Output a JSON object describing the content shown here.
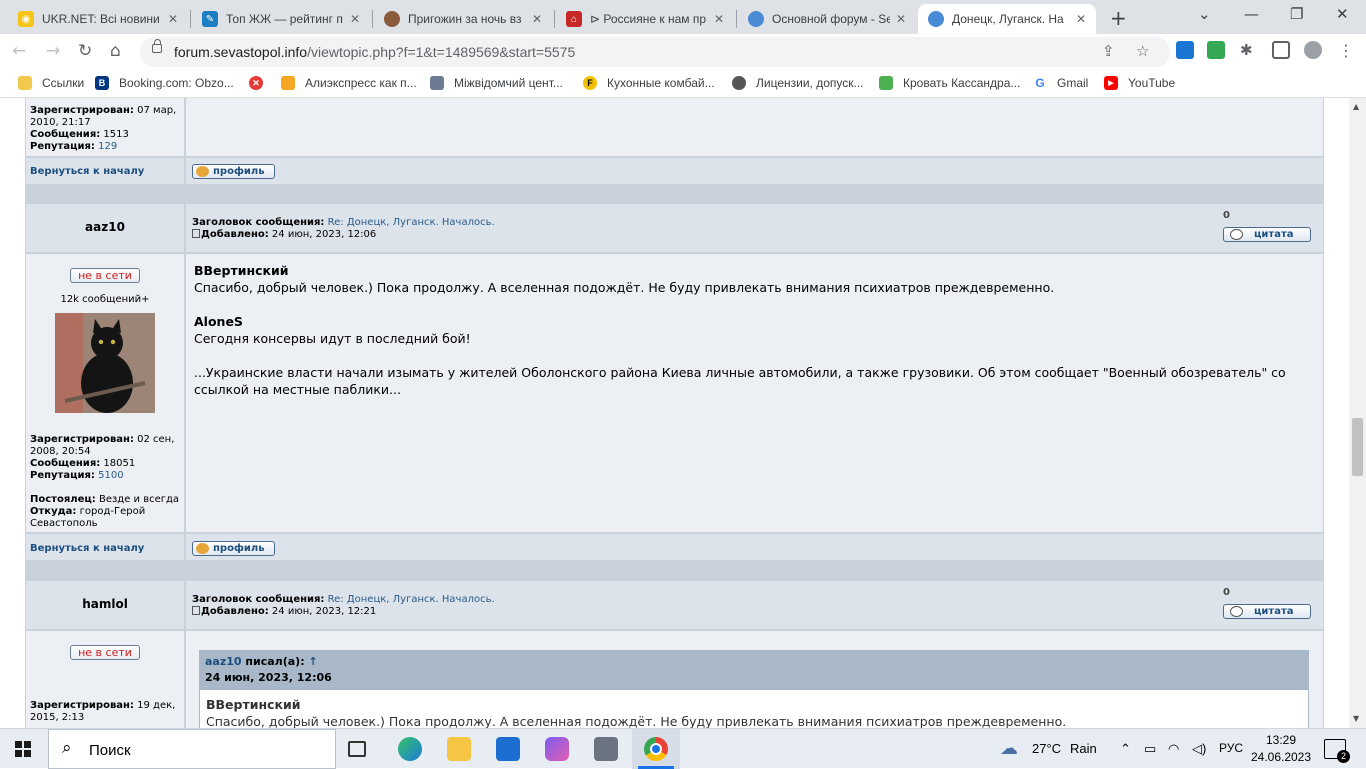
{
  "browser": {
    "tabs": [
      {
        "title": "UKR.NET: Всі новини",
        "icon": "ukrnet-icon",
        "color": "#f5c518"
      },
      {
        "title": "Топ ЖЖ — рейтинг п",
        "icon": "livejournal-icon",
        "color": "#1b7fc1"
      },
      {
        "title": "Пригожин за ночь вз",
        "icon": "portrait-icon",
        "color": "#8a5a3a"
      },
      {
        "title": "⊳ Россияне к нам пр",
        "icon": "house-icon",
        "color": "#c62828"
      },
      {
        "title": "Основной форум - Se",
        "icon": "forum-icon",
        "color": "#4a8bd6"
      },
      {
        "title": "Донецк, Луганск. На",
        "icon": "forum-icon",
        "color": "#4a8bd6"
      }
    ],
    "url_host": "forum.sevastopol.info",
    "url_path": "/viewtopic.php?f=1&t=1489569&start=5575",
    "bookmarks": [
      {
        "label": "Ссылки",
        "icon": "folder-icon",
        "color": "#f2c94c",
        "glyph": ""
      },
      {
        "label": "Booking.com: Obzo...",
        "icon": "booking-icon",
        "color": "#003580",
        "glyph": "B"
      },
      {
        "label": "",
        "icon": "red-x-icon",
        "color": "#e53935",
        "glyph": "✕"
      },
      {
        "label": "Алиэкспресс как п...",
        "icon": "box-icon",
        "color": "#f5a623",
        "glyph": ""
      },
      {
        "label": "Міжвідомчий цент...",
        "icon": "grid-icon",
        "color": "#6c7b95",
        "glyph": ""
      },
      {
        "label": "Кухонные комбай...",
        "icon": "yellow-circle-icon",
        "color": "#f2c200",
        "glyph": "F"
      },
      {
        "label": "Лицензии, допуск...",
        "icon": "globe-icon",
        "color": "#555555",
        "glyph": ""
      },
      {
        "label": "Кровать Кассандра...",
        "icon": "green-star-icon",
        "color": "#4caf50",
        "glyph": ""
      },
      {
        "label": "Gmail",
        "icon": "google-icon",
        "color": "#4285f4",
        "glyph": "G"
      },
      {
        "label": "YouTube",
        "icon": "youtube-icon",
        "color": "#ff0000",
        "glyph": "▶"
      }
    ]
  },
  "post_prev": {
    "registered_label": "Зарегистрирован:",
    "registered_value": "07 мар, 2010, 21:17",
    "messages_label": "Сообщения:",
    "messages_value": "1513",
    "reputation_label": "Репутация:",
    "reputation_value": "129",
    "back_link": "Вернуться к началу",
    "profile_btn": "профиль"
  },
  "post1": {
    "author": "aaz10",
    "subject_label": "Заголовок сообщения:",
    "subject_value": "Re: Донецк, Луганск. Началось.",
    "added_label": "Добавлено:",
    "added_value": "24 июн, 2023, 12:06",
    "rating": "0",
    "quote_btn": "цитата",
    "status": "не в сети",
    "msg_count": "12k сообщений+",
    "registered_label": "Зарегистрирован:",
    "registered_value": "02 сен, 2008, 20:54",
    "messages_label": "Сообщения:",
    "messages_value": "18051",
    "reputation_label": "Репутация:",
    "reputation_value": "5100",
    "resident_label": "Постоялец:",
    "resident_value": "Везде и всегда",
    "from_label": "Откуда:",
    "from_value": "город-Герой Севастополь",
    "body": {
      "name1": "BВертинский",
      "line1": "Спасибо, добрый человек.) Пока продолжу. А вселенная подождёт. Не буду привлекать внимания психиатров преждевременно.",
      "name2": "AloneS",
      "line2": "Сегодня консервы идут в последний бой!",
      "line3": "...Украинские власти начали изымать у жителей Оболонского района Киева личные автомобили, а также грузовики. Об этом сообщает \"Военный обозреватель\" со ссылкой на местные паблики..."
    },
    "back_link": "Вернуться к началу",
    "profile_btn": "профиль"
  },
  "post2": {
    "author": "hamlol",
    "subject_label": "Заголовок сообщения:",
    "subject_value": "Re: Донецк, Луганск. Началось.",
    "added_label": "Добавлено:",
    "added_value": "24 июн, 2023, 12:21",
    "rating": "0",
    "quote_btn": "цитата",
    "status": "не в сети",
    "registered_label": "Зарегистрирован:",
    "registered_value": "19 дек, 2015, 2:13",
    "quote_author": "aaz10",
    "quote_wrote": "писал(а):",
    "quote_arrow": "↑",
    "quote_date": "24 июн, 2023, 12:06",
    "quote_name": "BВертинский",
    "quote_line": "Спасибо, добрый человек.) Пока продолжу. А вселенная подождёт. Не буду привлекать внимания психиатров преждевременно."
  },
  "taskbar": {
    "search_placeholder": "Поиск",
    "weather_temp": "27°C",
    "weather_text": "Rain",
    "lang": "РУС",
    "time": "13:29",
    "date": "24.06.2023",
    "notifications": "2"
  }
}
